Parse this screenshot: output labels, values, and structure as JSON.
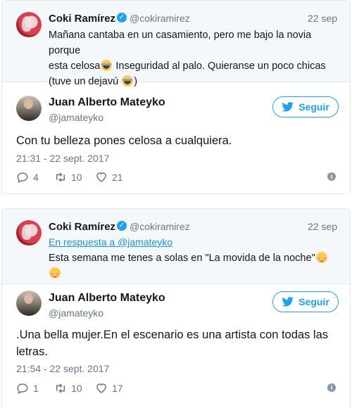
{
  "cards": [
    {
      "parent": {
        "name": "Coki Ramírez",
        "handle": "@cokiramirez",
        "date": "22 sep",
        "text_1": "Mañana cantaba en un casamiento, pero me bajo la novia porque",
        "text_2a": "esta celosa",
        "text_2b": " Inseguridad al palo. Quieranse un poco chicas",
        "text_3a": "(tuve un dejavú ",
        "text_3b": ")"
      },
      "main": {
        "name": "Juan Alberto Mateyko",
        "handle": "@jamateyko",
        "follow_label": "Seguir",
        "text_1": "Con tu belleza pones celosa a cualquiera.",
        "timestamp": "21:31 - 22 sept. 2017",
        "replies": "4",
        "retweets": "10",
        "likes": "21"
      }
    },
    {
      "parent": {
        "name": "Coki Ramírez",
        "handle": "@cokiramirez",
        "date": "22 sep",
        "reply_to": "En respuesta a @jamateyko",
        "text_1": "Esta semana me tenes a solas en \"La movida de la noche\""
      },
      "main": {
        "name": "Juan Alberto Mateyko",
        "handle": "@jamateyko",
        "follow_label": "Seguir",
        "text_1": ".Una bella mujer.En el escenario es una artista con todas las",
        "text_2": "letras.",
        "timestamp": "21:54 - 22 sept. 2017",
        "replies": "1",
        "retweets": "10",
        "likes": "17"
      }
    }
  ],
  "colors": {
    "accent": "#1da1f2",
    "link": "#1b95e0",
    "muted": "#657786",
    "border": "#e1e8ed",
    "parent_bg": "#f5f8fa"
  },
  "icons": {
    "verified": "verified-badge-icon",
    "reply": "reply-icon",
    "retweet": "retweet-icon",
    "like": "heart-icon",
    "info": "info-icon",
    "twitter": "twitter-bird-icon",
    "emoji_laugh": "tears-of-joy-emoji",
    "emoji_blush": "blushing-smile-emoji"
  }
}
